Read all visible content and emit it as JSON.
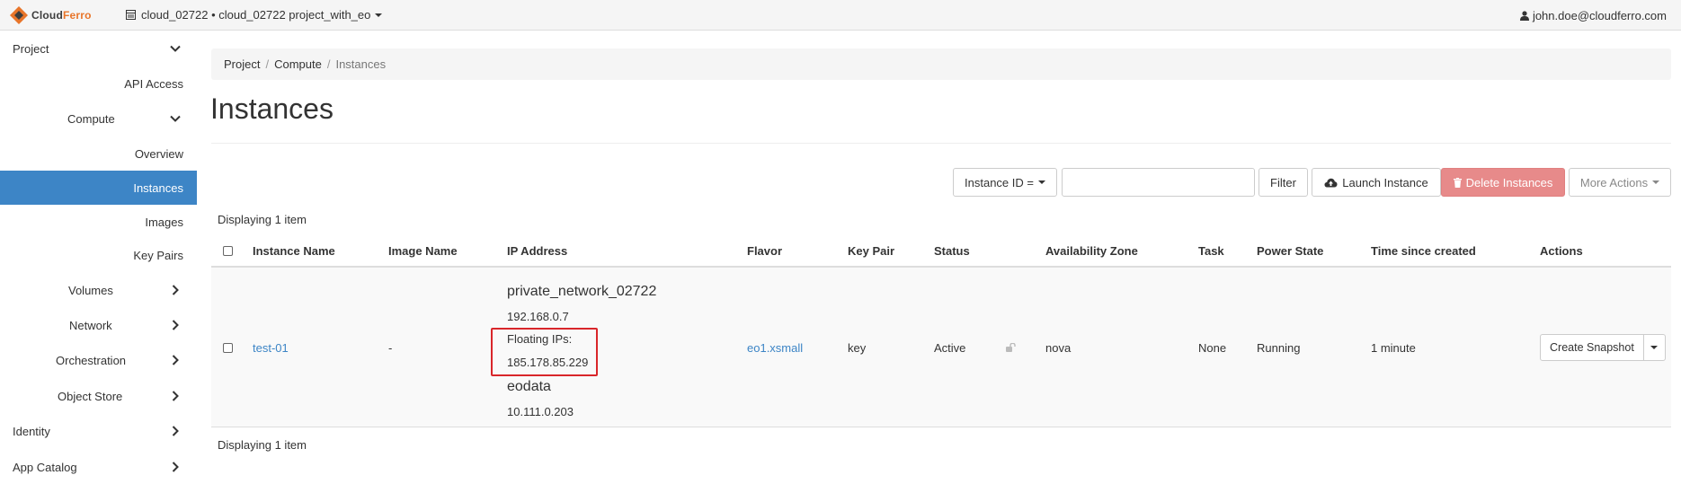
{
  "topbar": {
    "logo_cloud": "Cloud",
    "logo_ferro": "Ferro",
    "project_label": "cloud_02722 • cloud_02722 project_with_eo",
    "user": "john.doe@cloudferro.com"
  },
  "sidebar": {
    "project": "Project",
    "api_access": "API Access",
    "compute": "Compute",
    "overview": "Overview",
    "instances": "Instances",
    "images": "Images",
    "key_pairs": "Key Pairs",
    "volumes": "Volumes",
    "network": "Network",
    "orchestration": "Orchestration",
    "object_store": "Object Store",
    "identity": "Identity",
    "app_catalog": "App Catalog"
  },
  "breadcrumb": {
    "project": "Project",
    "compute": "Compute",
    "current": "Instances"
  },
  "page": {
    "title": "Instances"
  },
  "toolbar": {
    "filter_field": "Instance ID =",
    "filter_value": "",
    "filter_button": "Filter",
    "launch_button": "Launch Instance",
    "delete_button": "Delete Instances",
    "more_button": "More Actions"
  },
  "table": {
    "count_top": "Displaying 1 item",
    "count_bottom": "Displaying 1 item",
    "columns": {
      "instance_name": "Instance Name",
      "image_name": "Image Name",
      "ip_address": "IP Address",
      "flavor": "Flavor",
      "key_pair": "Key Pair",
      "status": "Status",
      "availability_zone": "Availability Zone",
      "task": "Task",
      "power_state": "Power State",
      "time_since_created": "Time since created",
      "actions": "Actions"
    },
    "rows": [
      {
        "instance_name": "test-01",
        "image_name": "-",
        "network_1": "private_network_02722",
        "ip_1": "192.168.0.7",
        "floating_label": "Floating IPs:",
        "floating_ip": "185.178.85.229",
        "network_2": "eodata",
        "ip_2": "10.111.0.203",
        "flavor": "eo1.xsmall",
        "key_pair": "key",
        "status": "Active",
        "availability_zone": "nova",
        "task": "None",
        "power_state": "Running",
        "time_since_created": "1 minute",
        "action": "Create Snapshot"
      }
    ]
  },
  "colors": {
    "accent": "#3d85c6",
    "danger": "#e78a8a",
    "highlight": "#d9262a",
    "logo_orange": "#e8752a"
  }
}
